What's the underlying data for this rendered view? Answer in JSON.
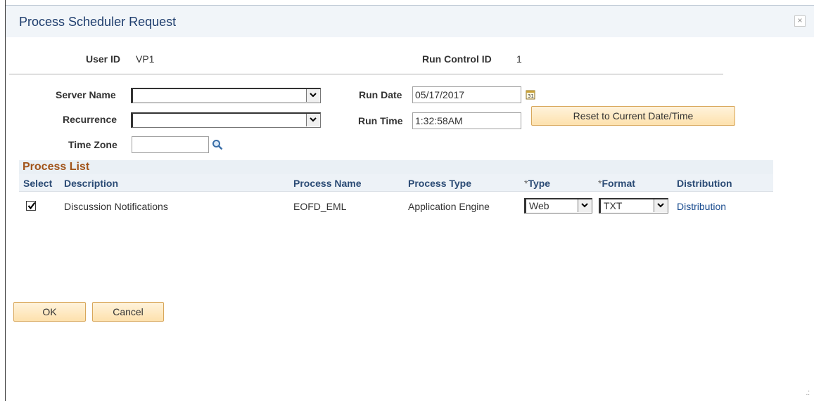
{
  "dialog": {
    "title": "Process Scheduler Request",
    "close_icon": "close-icon"
  },
  "header": {
    "user_id_label": "User ID",
    "user_id_value": "VP1",
    "run_control_label": "Run Control ID",
    "run_control_value": "1"
  },
  "form": {
    "server_name_label": "Server Name",
    "server_name_value": "",
    "recurrence_label": "Recurrence",
    "recurrence_value": "",
    "time_zone_label": "Time Zone",
    "time_zone_value": "",
    "run_date_label": "Run Date",
    "run_date_value": "05/17/2017",
    "run_time_label": "Run Time",
    "run_time_value": "1:32:58AM",
    "reset_button": "Reset to Current Date/Time"
  },
  "process_list": {
    "title": "Process List",
    "columns": {
      "select": "Select",
      "description": "Description",
      "process_name": "Process Name",
      "process_type": "Process Type",
      "type_required": "*",
      "type": "Type",
      "format_required": "*",
      "format": "Format",
      "distribution": "Distribution"
    },
    "rows": [
      {
        "selected": true,
        "description": "Discussion Notifications",
        "process_name": "EOFD_EML",
        "process_type": "Application Engine",
        "type": "Web",
        "format": "TXT",
        "distribution": "Distribution"
      }
    ]
  },
  "footer": {
    "ok_button": "OK",
    "cancel_button": "Cancel"
  },
  "colors": {
    "title": "#1f3e6e",
    "section_title": "#a1541a",
    "header_text": "#2b4b75",
    "link": "#1a4c8f",
    "button_bg": "#fde1ad"
  }
}
